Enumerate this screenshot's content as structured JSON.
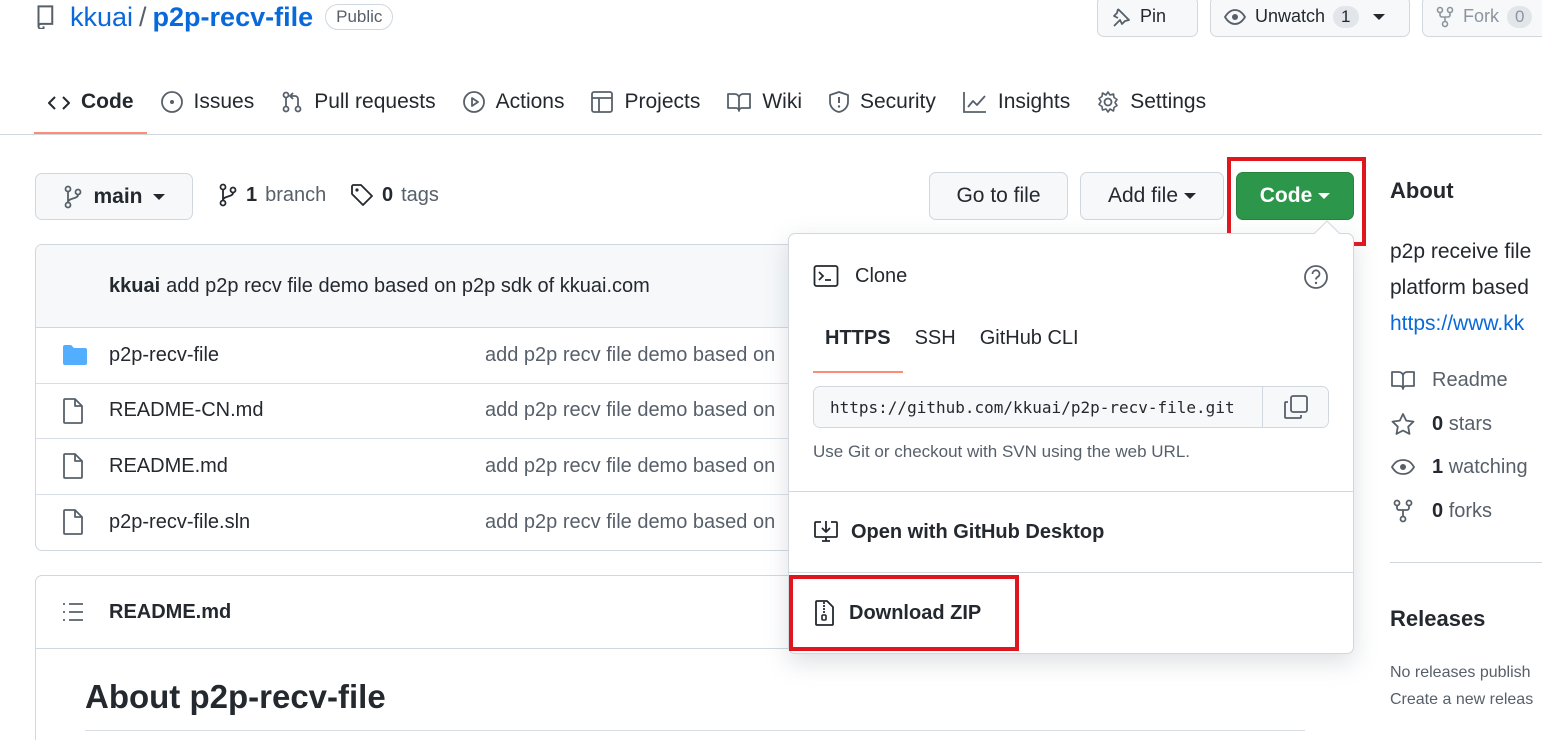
{
  "repo": {
    "owner": "kkuai",
    "separator": "/",
    "name": "p2p-recv-file",
    "visibility": "Public"
  },
  "header_actions": {
    "pin": "Pin",
    "unwatch": "Unwatch",
    "watch_count": "1",
    "fork": "Fork",
    "fork_count": "0"
  },
  "tabs": [
    {
      "label": "Code"
    },
    {
      "label": "Issues"
    },
    {
      "label": "Pull requests"
    },
    {
      "label": "Actions"
    },
    {
      "label": "Projects"
    },
    {
      "label": "Wiki"
    },
    {
      "label": "Security"
    },
    {
      "label": "Insights"
    },
    {
      "label": "Settings"
    }
  ],
  "branch_bar": {
    "branch": "main",
    "branch_count": "1",
    "branch_label": "branch",
    "tag_count": "0",
    "tag_label": "tags",
    "go_to_file": "Go to file",
    "add_file": "Add file",
    "code": "Code"
  },
  "latest_commit": {
    "author": "kkuai",
    "message": "add p2p recv file demo based on p2p sdk of kkuai.com"
  },
  "files": [
    {
      "name": "p2p-recv-file",
      "message": "add p2p recv file demo based on",
      "type": "folder"
    },
    {
      "name": "README-CN.md",
      "message": "add p2p recv file demo based on",
      "type": "file"
    },
    {
      "name": "README.md",
      "message": "add p2p recv file demo based on",
      "type": "file"
    },
    {
      "name": "p2p-recv-file.sln",
      "message": "add p2p recv file demo based on",
      "type": "file"
    }
  ],
  "readme": {
    "filename": "README.md",
    "heading": "About p2p-recv-file"
  },
  "clone_dropdown": {
    "title": "Clone",
    "tabs": [
      "HTTPS",
      "SSH",
      "GitHub CLI"
    ],
    "url": "https://github.com/kkuai/p2p-recv-file.git",
    "hint": "Use Git or checkout with SVN using the web URL.",
    "open_desktop": "Open with GitHub Desktop",
    "download_zip": "Download ZIP"
  },
  "sidebar": {
    "about_heading": "About",
    "description_line1": "p2p receive file",
    "description_line2": "platform based",
    "website": "https://www.kk",
    "readme": "Readme",
    "stars_count": "0",
    "stars_label": "stars",
    "watching_count": "1",
    "watching_label": "watching",
    "forks_count": "0",
    "forks_label": "forks",
    "releases_heading": "Releases",
    "no_releases": "No releases publish",
    "create_release": "Create a new releas"
  },
  "colors": {
    "link": "#0969da",
    "code_button": "#2c974b",
    "highlight": "#e0161e",
    "active_tab_underline": "#fd8c73",
    "folder": "#54aeff"
  }
}
